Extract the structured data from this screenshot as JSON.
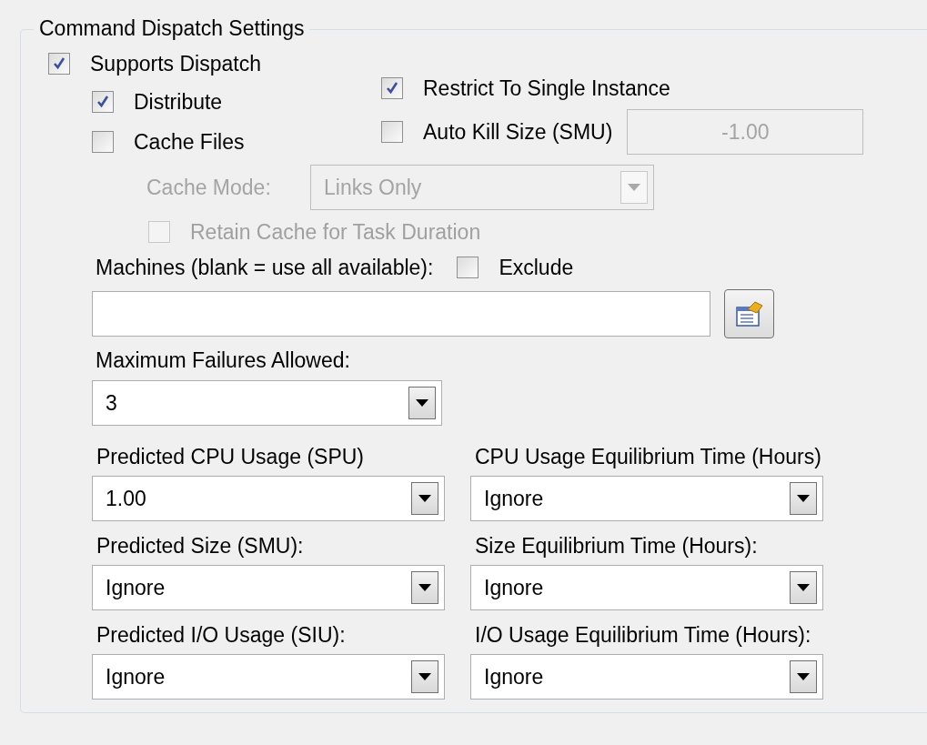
{
  "group": {
    "title": "Command Dispatch Settings"
  },
  "supports_dispatch": {
    "label": "Supports Dispatch",
    "checked": true
  },
  "left_options": [
    {
      "label": "Distribute",
      "checked": true
    },
    {
      "label": "Cache Files",
      "checked": false
    }
  ],
  "restrict_single": {
    "label": "Restrict To Single Instance",
    "checked": true
  },
  "auto_kill": {
    "label": "Auto Kill Size (SMU)",
    "checked": false,
    "value": "-1.00",
    "disabled": true
  },
  "cache_mode": {
    "label": "Cache Mode:",
    "value": "Links Only",
    "disabled": true
  },
  "retain_cache": {
    "label": "Retain Cache for Task Duration",
    "checked": false,
    "disabled": true
  },
  "machines": {
    "label": "Machines (blank = use all available):",
    "exclude": {
      "label": "Exclude",
      "checked": false
    }
  },
  "max_failures": {
    "label": "Maximum Failures Allowed:",
    "value": "3"
  },
  "predictions": [
    {
      "label": "Predicted CPU Usage (SPU)",
      "value": "1.00"
    },
    {
      "label": "CPU Usage Equilibrium Time (Hours)",
      "value": "Ignore"
    },
    {
      "label": "Predicted Size (SMU):",
      "value": "Ignore"
    },
    {
      "label": "Size Equilibrium Time (Hours):",
      "value": "Ignore"
    },
    {
      "label": "Predicted I/O Usage (SIU):",
      "value": "Ignore"
    },
    {
      "label": "I/O Usage Equilibrium Time (Hours):",
      "value": "Ignore"
    }
  ]
}
